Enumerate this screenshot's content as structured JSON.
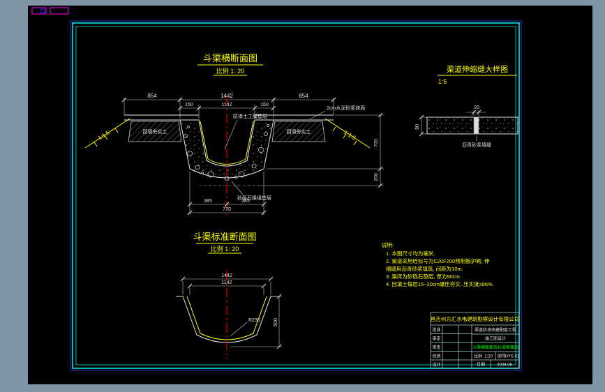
{
  "page": {
    "outer_bg": "#7e93a5",
    "canvas_bg": "#000000"
  },
  "colors": {
    "frame": "#00e5e5",
    "accent_yellow": "#ffff00",
    "accent_green": "#00ff00",
    "centerline_red": "#ff0000"
  },
  "cross_section": {
    "title": "斗渠横断面图",
    "scale": "比例 1: 20",
    "labels": {
      "fill_left": "回填夯实土",
      "fill_right": "回填夯实土",
      "slope_left": "1:1.5",
      "slope_right": "1:1.5",
      "membrane": "防渗土工膜垫层",
      "cushion": "砂砾石换填垫层",
      "mortar": "2cm水泥砂浆抹面"
    },
    "dims": {
      "top_left": "854",
      "top_mid": "1442",
      "top_right": "854",
      "flange_left": "150",
      "inner_top": "1142",
      "flange_right": "150",
      "bottom_left": "385",
      "bottom_right": "385",
      "bottom_total": "770",
      "depth": "700",
      "cushion_h": "200"
    }
  },
  "joint_detail": {
    "title": "渠道伸缩缝大样图",
    "scale": "1:5",
    "labels": {
      "filler": "沥青砂浆填缝"
    },
    "dims": {
      "gap": "20",
      "thickness": "80"
    }
  },
  "standard_section": {
    "title": "斗渠标准断面图",
    "scale": "比例 1: 20",
    "dims": {
      "top": "1442",
      "inner_top": "1142",
      "depth": "500",
      "radius": "R230"
    }
  },
  "notes": {
    "lines": [
      "说明:",
      "1. 本图尺寸均为毫米.",
      "2. 渠道采用砼标号为C20F200预制板护砌, 伸",
      "    缩缝用沥青砂浆填筑, 间距为10m.",
      "3. 渠床为砂砾石垫层, 厚为90cm.",
      "4. 回填土每层15~20cm碾压夯实, 压实度≥96%."
    ]
  },
  "title_block": {
    "company": "昌吉州方汇水电建筑勘察设计有限公司",
    "rows": [
      "批准",
      "审定",
      "审查",
      "校核",
      "设计"
    ],
    "project": "渠道防渗改建配套工程",
    "stage": "施工图设计",
    "drawing_title": "斗渠横断面及标准断面图",
    "scale_label": "比例",
    "scale_value": "1:20",
    "no_label": "图号",
    "no_value": "HYS-01",
    "date_label": "日期",
    "date_value": "2008.06"
  }
}
